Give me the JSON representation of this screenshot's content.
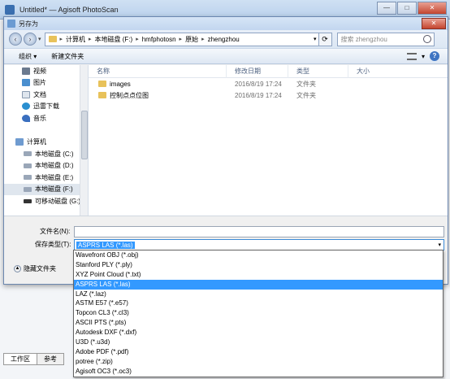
{
  "app": {
    "title": "Untitled* — Agisoft PhotoScan",
    "min": "—",
    "max": "□",
    "close": "✕",
    "bottom_tabs": [
      "工作区",
      "参考"
    ]
  },
  "dialog": {
    "title": "另存为",
    "close": "✕",
    "back": "‹",
    "forward": "›",
    "breadcrumbs": [
      "计算机",
      "本地磁盘 (F:)",
      "hmfphotosn",
      "原始",
      "zhengzhou"
    ],
    "search_placeholder": "搜索 zhengzhou",
    "toolbar": {
      "organize": "组织 ▾",
      "new_folder": "新建文件夹",
      "help": "?"
    },
    "nav": {
      "favorites": [
        "视频",
        "图片",
        "文档",
        "迅雷下载",
        "音乐"
      ],
      "computer": "计算机",
      "drives": [
        "本地磁盘 (C:)",
        "本地磁盘 (D:)",
        "本地磁盘 (E:)",
        "本地磁盘 (F:)",
        "可移动磁盘 (G:)"
      ]
    },
    "columns": [
      "名称",
      "修改日期",
      "类型",
      "大小"
    ],
    "files": [
      {
        "name": "images",
        "date": "2016/8/19 17:24",
        "type": "文件夹"
      },
      {
        "name": "控制点点位图",
        "date": "2016/8/19 17:24",
        "type": "文件夹"
      }
    ],
    "filename_label": "文件名(N):",
    "filename_value": "",
    "filetype_label": "保存类型(T):",
    "filetype_value": "ASPRS LAS (*.las)",
    "hide_folders": "隐藏文件夹",
    "filetype_options": [
      "Wavefront OBJ (*.obj)",
      "Stanford PLY (*.ply)",
      "XYZ Point Cloud (*.txt)",
      "ASPRS LAS (*.las)",
      "LAZ (*.laz)",
      "ASTM E57 (*.e57)",
      "Topcon CL3 (*.cl3)",
      "ASCII PTS (*.pts)",
      "Autodesk DXF (*.dxf)",
      "U3D (*.u3d)",
      "Adobe PDF (*.pdf)",
      "potree (*.zip)",
      "Agisoft OC3 (*.oc3)"
    ],
    "highlighted_option": "ASPRS LAS (*.las)"
  }
}
